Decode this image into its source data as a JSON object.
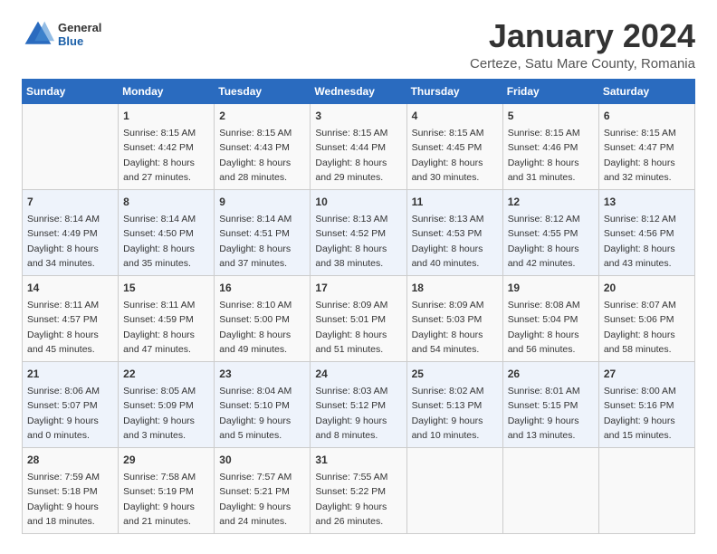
{
  "header": {
    "logo_general": "General",
    "logo_blue": "Blue",
    "title": "January 2024",
    "subtitle": "Certeze, Satu Mare County, Romania"
  },
  "weekdays": [
    "Sunday",
    "Monday",
    "Tuesday",
    "Wednesday",
    "Thursday",
    "Friday",
    "Saturday"
  ],
  "weeks": [
    [
      {
        "day": "",
        "sunrise": "",
        "sunset": "",
        "daylight": ""
      },
      {
        "day": "1",
        "sunrise": "Sunrise: 8:15 AM",
        "sunset": "Sunset: 4:42 PM",
        "daylight": "Daylight: 8 hours and 27 minutes."
      },
      {
        "day": "2",
        "sunrise": "Sunrise: 8:15 AM",
        "sunset": "Sunset: 4:43 PM",
        "daylight": "Daylight: 8 hours and 28 minutes."
      },
      {
        "day": "3",
        "sunrise": "Sunrise: 8:15 AM",
        "sunset": "Sunset: 4:44 PM",
        "daylight": "Daylight: 8 hours and 29 minutes."
      },
      {
        "day": "4",
        "sunrise": "Sunrise: 8:15 AM",
        "sunset": "Sunset: 4:45 PM",
        "daylight": "Daylight: 8 hours and 30 minutes."
      },
      {
        "day": "5",
        "sunrise": "Sunrise: 8:15 AM",
        "sunset": "Sunset: 4:46 PM",
        "daylight": "Daylight: 8 hours and 31 minutes."
      },
      {
        "day": "6",
        "sunrise": "Sunrise: 8:15 AM",
        "sunset": "Sunset: 4:47 PM",
        "daylight": "Daylight: 8 hours and 32 minutes."
      }
    ],
    [
      {
        "day": "7",
        "sunrise": "Sunrise: 8:14 AM",
        "sunset": "Sunset: 4:49 PM",
        "daylight": "Daylight: 8 hours and 34 minutes."
      },
      {
        "day": "8",
        "sunrise": "Sunrise: 8:14 AM",
        "sunset": "Sunset: 4:50 PM",
        "daylight": "Daylight: 8 hours and 35 minutes."
      },
      {
        "day": "9",
        "sunrise": "Sunrise: 8:14 AM",
        "sunset": "Sunset: 4:51 PM",
        "daylight": "Daylight: 8 hours and 37 minutes."
      },
      {
        "day": "10",
        "sunrise": "Sunrise: 8:13 AM",
        "sunset": "Sunset: 4:52 PM",
        "daylight": "Daylight: 8 hours and 38 minutes."
      },
      {
        "day": "11",
        "sunrise": "Sunrise: 8:13 AM",
        "sunset": "Sunset: 4:53 PM",
        "daylight": "Daylight: 8 hours and 40 minutes."
      },
      {
        "day": "12",
        "sunrise": "Sunrise: 8:12 AM",
        "sunset": "Sunset: 4:55 PM",
        "daylight": "Daylight: 8 hours and 42 minutes."
      },
      {
        "day": "13",
        "sunrise": "Sunrise: 8:12 AM",
        "sunset": "Sunset: 4:56 PM",
        "daylight": "Daylight: 8 hours and 43 minutes."
      }
    ],
    [
      {
        "day": "14",
        "sunrise": "Sunrise: 8:11 AM",
        "sunset": "Sunset: 4:57 PM",
        "daylight": "Daylight: 8 hours and 45 minutes."
      },
      {
        "day": "15",
        "sunrise": "Sunrise: 8:11 AM",
        "sunset": "Sunset: 4:59 PM",
        "daylight": "Daylight: 8 hours and 47 minutes."
      },
      {
        "day": "16",
        "sunrise": "Sunrise: 8:10 AM",
        "sunset": "Sunset: 5:00 PM",
        "daylight": "Daylight: 8 hours and 49 minutes."
      },
      {
        "day": "17",
        "sunrise": "Sunrise: 8:09 AM",
        "sunset": "Sunset: 5:01 PM",
        "daylight": "Daylight: 8 hours and 51 minutes."
      },
      {
        "day": "18",
        "sunrise": "Sunrise: 8:09 AM",
        "sunset": "Sunset: 5:03 PM",
        "daylight": "Daylight: 8 hours and 54 minutes."
      },
      {
        "day": "19",
        "sunrise": "Sunrise: 8:08 AM",
        "sunset": "Sunset: 5:04 PM",
        "daylight": "Daylight: 8 hours and 56 minutes."
      },
      {
        "day": "20",
        "sunrise": "Sunrise: 8:07 AM",
        "sunset": "Sunset: 5:06 PM",
        "daylight": "Daylight: 8 hours and 58 minutes."
      }
    ],
    [
      {
        "day": "21",
        "sunrise": "Sunrise: 8:06 AM",
        "sunset": "Sunset: 5:07 PM",
        "daylight": "Daylight: 9 hours and 0 minutes."
      },
      {
        "day": "22",
        "sunrise": "Sunrise: 8:05 AM",
        "sunset": "Sunset: 5:09 PM",
        "daylight": "Daylight: 9 hours and 3 minutes."
      },
      {
        "day": "23",
        "sunrise": "Sunrise: 8:04 AM",
        "sunset": "Sunset: 5:10 PM",
        "daylight": "Daylight: 9 hours and 5 minutes."
      },
      {
        "day": "24",
        "sunrise": "Sunrise: 8:03 AM",
        "sunset": "Sunset: 5:12 PM",
        "daylight": "Daylight: 9 hours and 8 minutes."
      },
      {
        "day": "25",
        "sunrise": "Sunrise: 8:02 AM",
        "sunset": "Sunset: 5:13 PM",
        "daylight": "Daylight: 9 hours and 10 minutes."
      },
      {
        "day": "26",
        "sunrise": "Sunrise: 8:01 AM",
        "sunset": "Sunset: 5:15 PM",
        "daylight": "Daylight: 9 hours and 13 minutes."
      },
      {
        "day": "27",
        "sunrise": "Sunrise: 8:00 AM",
        "sunset": "Sunset: 5:16 PM",
        "daylight": "Daylight: 9 hours and 15 minutes."
      }
    ],
    [
      {
        "day": "28",
        "sunrise": "Sunrise: 7:59 AM",
        "sunset": "Sunset: 5:18 PM",
        "daylight": "Daylight: 9 hours and 18 minutes."
      },
      {
        "day": "29",
        "sunrise": "Sunrise: 7:58 AM",
        "sunset": "Sunset: 5:19 PM",
        "daylight": "Daylight: 9 hours and 21 minutes."
      },
      {
        "day": "30",
        "sunrise": "Sunrise: 7:57 AM",
        "sunset": "Sunset: 5:21 PM",
        "daylight": "Daylight: 9 hours and 24 minutes."
      },
      {
        "day": "31",
        "sunrise": "Sunrise: 7:55 AM",
        "sunset": "Sunset: 5:22 PM",
        "daylight": "Daylight: 9 hours and 26 minutes."
      },
      {
        "day": "",
        "sunrise": "",
        "sunset": "",
        "daylight": ""
      },
      {
        "day": "",
        "sunrise": "",
        "sunset": "",
        "daylight": ""
      },
      {
        "day": "",
        "sunrise": "",
        "sunset": "",
        "daylight": ""
      }
    ]
  ]
}
